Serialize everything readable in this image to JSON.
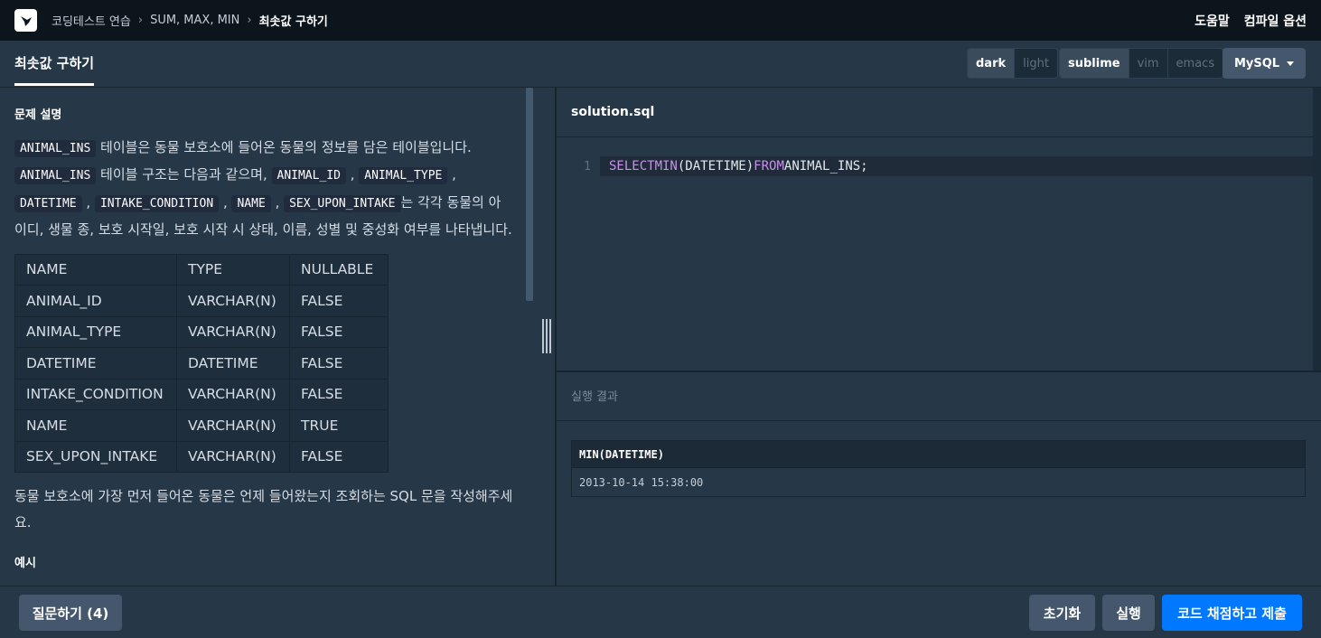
{
  "nav": {
    "breadcrumb": [
      "코딩테스트 연습",
      "SUM, MAX, MIN",
      "최솟값 구하기"
    ],
    "help": "도움말",
    "compile_options": "컴파일 옵션"
  },
  "tabs": {
    "active": "최솟값 구하기"
  },
  "editor_options": {
    "theme": [
      "dark",
      "light"
    ],
    "keymap": [
      "sublime",
      "vim",
      "emacs"
    ],
    "language": "MySQL"
  },
  "problem": {
    "section_title": "문제 설명",
    "intro_code_1": "ANIMAL_INS",
    "intro_text_1": " 테이블은 동물 보호소에 들어온 동물의 정보를 담은 테이블입니다. ",
    "intro_code_2": "ANIMAL_INS",
    "intro_text_2": " 테이블 구조는 다음과 같으며, ",
    "col_codes": [
      "ANIMAL_ID",
      "ANIMAL_TYPE",
      "DATETIME",
      "INTAKE_CONDITION",
      "NAME",
      "SEX_UPON_INTAKE"
    ],
    "intro_text_3": "는 각각 동물의 아이디, 생물 종, 보호 시작일, 보호 시작 시 상태, 이름, 성별 및 중성화 여부를 나타냅니다.",
    "schema_header": [
      "NAME",
      "TYPE",
      "NULLABLE"
    ],
    "schema_rows": [
      [
        "ANIMAL_ID",
        "VARCHAR(N)",
        "FALSE"
      ],
      [
        "ANIMAL_TYPE",
        "VARCHAR(N)",
        "FALSE"
      ],
      [
        "DATETIME",
        "DATETIME",
        "FALSE"
      ],
      [
        "INTAKE_CONDITION",
        "VARCHAR(N)",
        "FALSE"
      ],
      [
        "NAME",
        "VARCHAR(N)",
        "TRUE"
      ],
      [
        "SEX_UPON_INTAKE",
        "VARCHAR(N)",
        "FALSE"
      ]
    ],
    "task": "동물 보호소에 가장 먼저 들어온 동물은 언제 들어왔는지 조회하는 SQL 문을 작성해주세요.",
    "next_section_partial": "예시"
  },
  "editor": {
    "filename": "solution.sql",
    "line_number": "1",
    "kw_select": "SELECT",
    "kw_min": "MIN",
    "arg": "(DATETIME)",
    "kw_from": "FROM",
    "table": "ANIMAL_INS;"
  },
  "result": {
    "title": "실행 결과",
    "header": "MIN(DATETIME)",
    "value": "2013-10-14 15:38:00"
  },
  "buttons": {
    "question": "질문하기 (4)",
    "reset": "초기화",
    "run": "실행",
    "submit": "코드 채점하고 제출"
  }
}
